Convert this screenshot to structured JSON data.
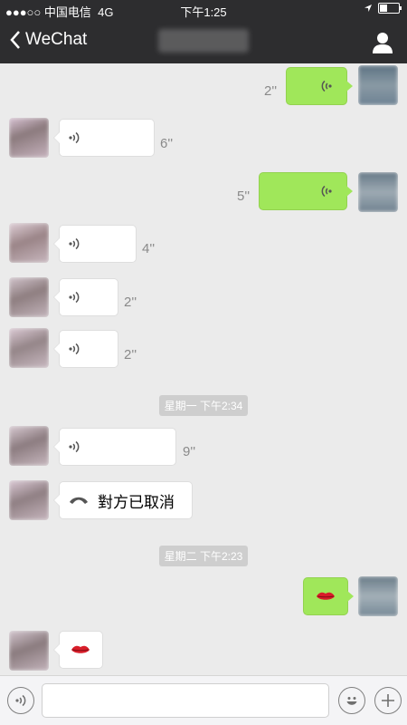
{
  "status_bar": {
    "signal": "●●●○○",
    "carrier": "中国电信",
    "network": "4G",
    "time": "下午1:25"
  },
  "nav": {
    "back_label": "WeChat",
    "icons": {
      "back": "chevron-left-icon",
      "profile": "person-icon"
    }
  },
  "messages": [
    {
      "side": "right",
      "type": "voice",
      "duration": "2''"
    },
    {
      "side": "left",
      "type": "voice",
      "duration": "6''"
    },
    {
      "side": "right",
      "type": "voice",
      "duration": "5''"
    },
    {
      "side": "left",
      "type": "voice",
      "duration": "4''"
    },
    {
      "side": "left",
      "type": "voice",
      "duration": "2''"
    },
    {
      "side": "left",
      "type": "voice",
      "duration": "2''"
    },
    {
      "type": "timestamp",
      "text": "星期一 下午2:34"
    },
    {
      "side": "left",
      "type": "voice",
      "duration": "9''"
    },
    {
      "side": "left",
      "type": "call",
      "text": "對方已取消"
    },
    {
      "type": "timestamp",
      "text": "星期二 下午2:23"
    },
    {
      "side": "right",
      "type": "emoji",
      "emoji": "lips-icon"
    },
    {
      "side": "left",
      "type": "emoji",
      "emoji": "lips-icon"
    }
  ],
  "input_bar": {
    "value": "",
    "placeholder": "",
    "icons": {
      "voice": "voice-icon",
      "emoji": "smiley-icon",
      "more": "plus-icon"
    }
  },
  "colors": {
    "bar": "#2d2d2f",
    "chat_bg": "#ebebeb",
    "bubble_self": "#a0e75a",
    "bubble_other": "#ffffff",
    "timestamp_bg": "#cecece"
  }
}
